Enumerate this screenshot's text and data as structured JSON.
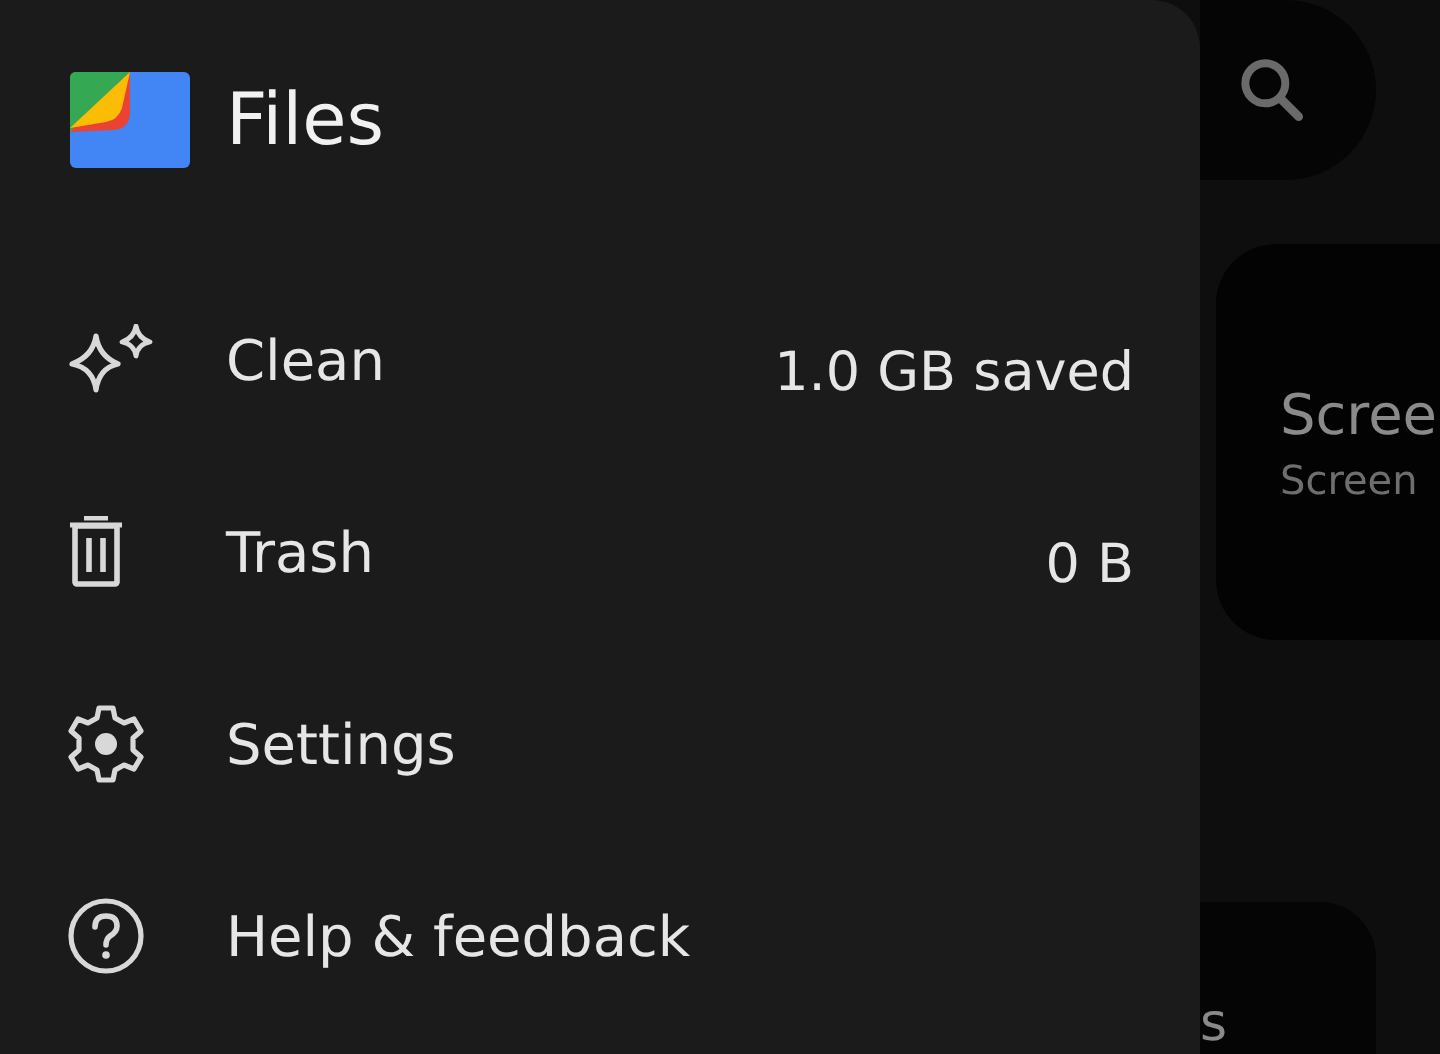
{
  "drawer": {
    "title": "Files",
    "items": [
      {
        "kind": "clean",
        "label": "Clean",
        "value": "1.0 GB saved"
      },
      {
        "kind": "trash",
        "label": "Trash",
        "value": "0 B"
      },
      {
        "kind": "settings",
        "label": "Settings"
      },
      {
        "kind": "help",
        "label": "Help & feedback"
      }
    ]
  },
  "background": {
    "card": {
      "title": "Scree",
      "subtitle": "Screen"
    },
    "bottom_card": {
      "text": "s"
    }
  }
}
